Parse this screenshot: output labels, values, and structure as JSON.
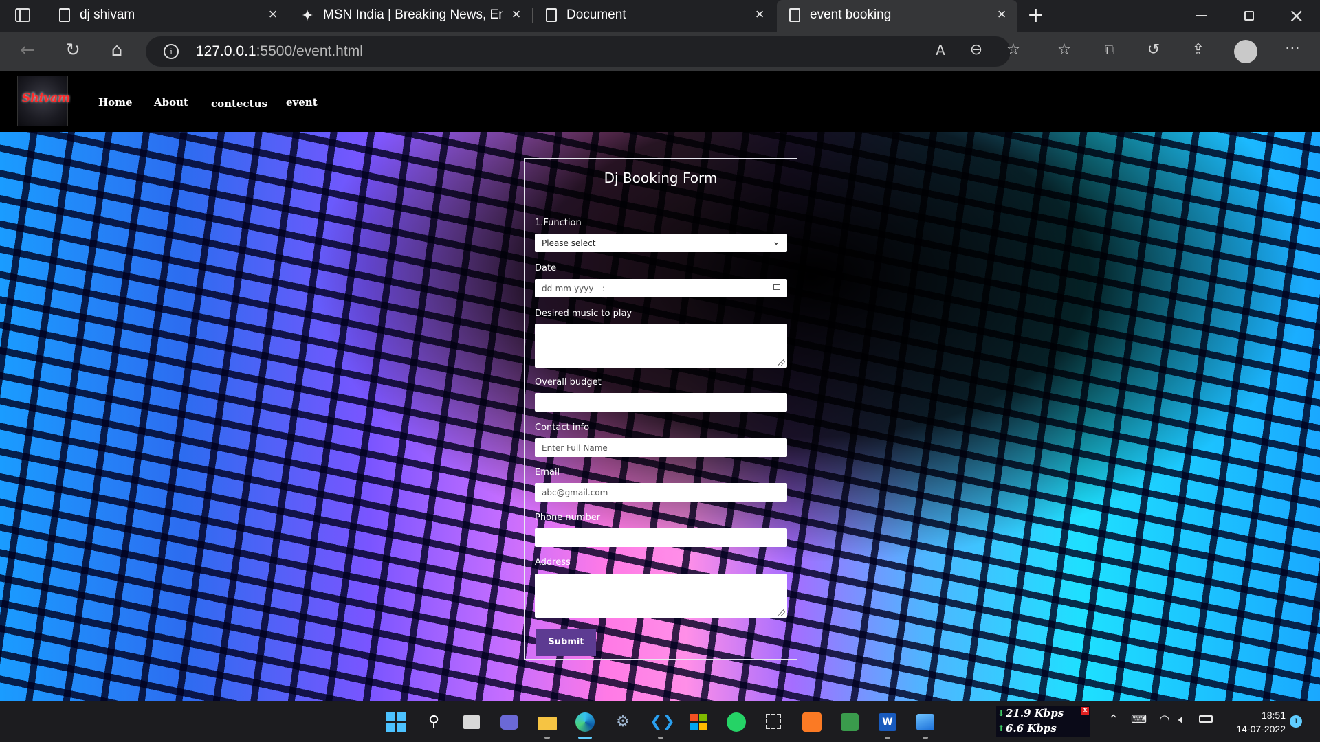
{
  "browser": {
    "tabs": [
      {
        "title": "dj shivam"
      },
      {
        "title": "MSN India | Breaking News, Ente"
      },
      {
        "title": "Document"
      },
      {
        "title": "event booking"
      }
    ],
    "url_host": "127.0.0.1",
    "url_rest": ":5500/event.html"
  },
  "site": {
    "logo_text": "Shivam",
    "nav": [
      "Home",
      "About",
      "contectus",
      "event"
    ]
  },
  "form": {
    "title": "Dj Booking Form",
    "function_label": "1.Function",
    "function_value": "Please select",
    "date_label": "Date",
    "date_placeholder": "dd-mm-yyyy --:--",
    "music_label": "Desired music to play",
    "budget_label": "Overall budget",
    "contact_label": "Contact info",
    "contact_placeholder": "Enter Full Name",
    "email_label": "Email",
    "email_placeholder": "abc@gmail.com",
    "phone_label": "Phone number",
    "address_label": "Address",
    "submit_label": "Submit"
  },
  "taskbar": {
    "net_down": "21.9 Kbps",
    "net_up": "6.6 Kbps",
    "time": "18:51",
    "date": "14-07-2022",
    "notification_count": "1"
  }
}
